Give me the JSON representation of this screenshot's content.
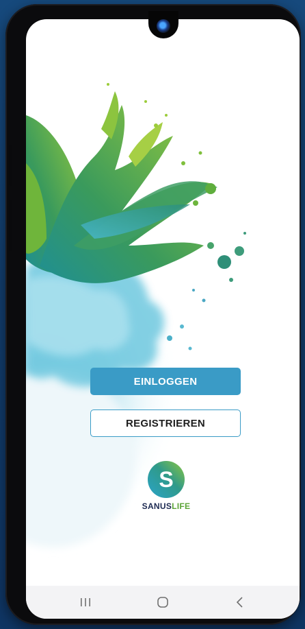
{
  "app": {
    "brand_part1": "SANUS",
    "brand_part2": "LIFE",
    "logo_letter": "S"
  },
  "actions": {
    "login_label": "EINLOGGEN",
    "register_label": "REGISTRIEREN"
  },
  "navbar": {
    "items": [
      "recent-apps-icon",
      "home-icon",
      "back-icon"
    ]
  },
  "colors": {
    "accent": "#3a9bc6",
    "brand_dark": "#1d2a52",
    "brand_green": "#5ca438",
    "background": "#14457a"
  }
}
